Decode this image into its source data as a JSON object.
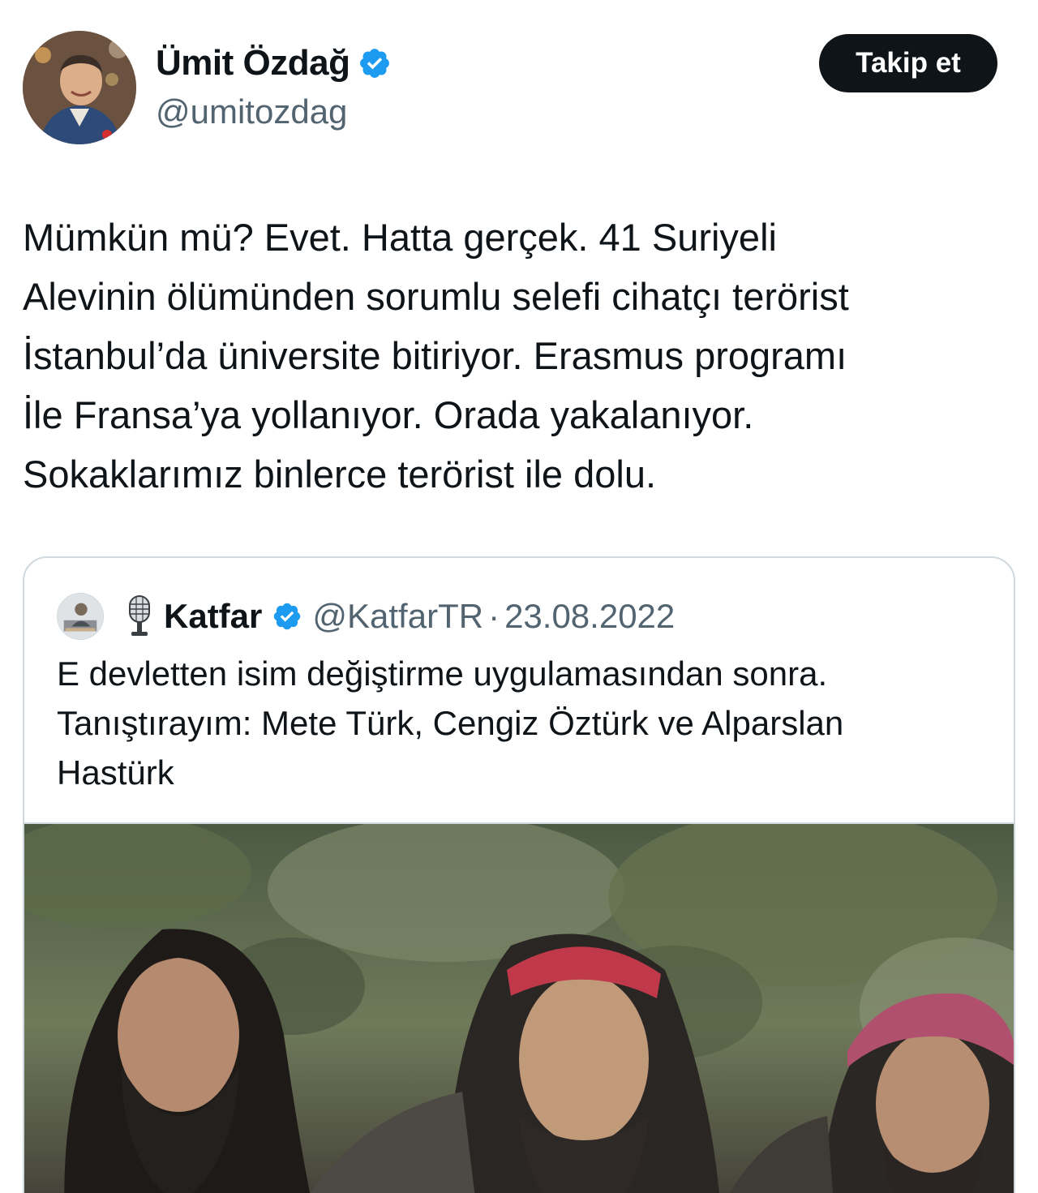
{
  "author": {
    "name": "Ümit Özdağ",
    "handle": "@umitozdag",
    "verified": true,
    "avatar_icon": "profile-photo"
  },
  "follow_button": {
    "label": "Takip et"
  },
  "tweet": {
    "lines": [
      "Mümkün mü? Evet. Hatta gerçek. 41 Suriyeli",
      "Alevinin ölümünden sorumlu selefi cihatçı terörist",
      "İstanbul’da üniversite bitiriyor. Erasmus programı",
      "İle Fransa’ya yollanıyor. Orada yakalanıyor.",
      "Sokaklarımız binlerce terörist ile dolu."
    ]
  },
  "quoted_tweet": {
    "name": "Katfar",
    "handle": "@KatfarTR",
    "separator": "·",
    "date": "23.08.2022",
    "verified": true,
    "emoji_icon": "microphone-icon",
    "lines": [
      "E devletten isim değiştirme uygulamasından sonra.",
      "Tanıştırayım: Mete Türk, Cengiz Öztürk ve Alparslan",
      "Hastürk"
    ],
    "media": "photo-three-men"
  },
  "colors": {
    "text": "#0f1419",
    "secondary": "#536471",
    "verified_blue": "#1d9bf0",
    "button_bg": "#0f1419",
    "border": "#cfd9de"
  }
}
